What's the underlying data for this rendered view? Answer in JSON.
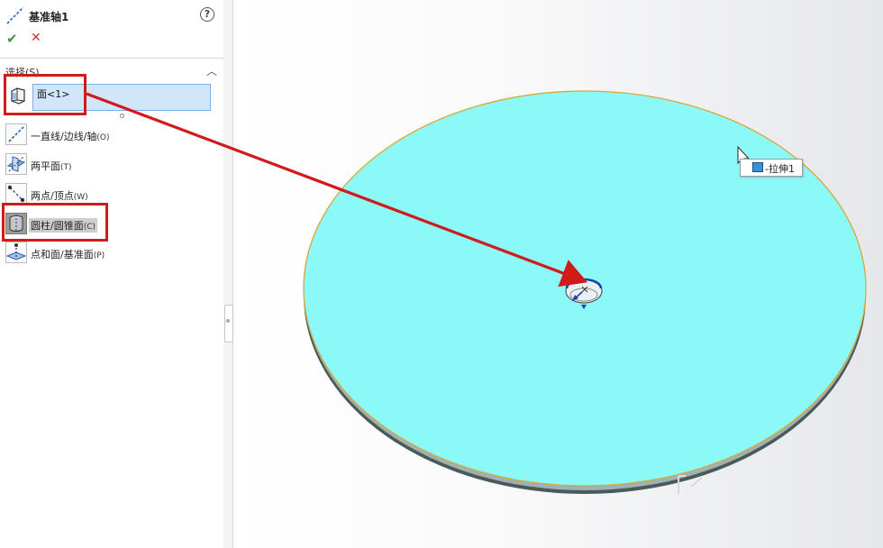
{
  "feature": {
    "title": "基准轴1",
    "help_label": "?",
    "ok_icon": "check-icon",
    "cancel_icon": "close-icon"
  },
  "selection": {
    "header": "选择(S)",
    "selected_item": "面<1>"
  },
  "axis_types": [
    {
      "label": "一直线/边线/轴",
      "shortcut": "(O)",
      "icon": "line-edge-axis-icon",
      "active": false
    },
    {
      "label": "两平面",
      "shortcut": "(T)",
      "icon": "two-planes-icon",
      "active": false
    },
    {
      "label": "两点/顶点",
      "shortcut": "(W)",
      "icon": "two-points-icon",
      "active": false
    },
    {
      "label": "圆柱/圆锥面",
      "shortcut": "(C)",
      "icon": "cylinder-cone-icon",
      "active": true
    },
    {
      "label": "点和面/基准面",
      "shortcut": "(P)",
      "icon": "point-plane-icon",
      "active": false
    }
  ],
  "viewport": {
    "tooltip_label": "-拉伸1",
    "face_color": "#8cf9f9",
    "edge_color": "#d8a838",
    "annotation_color": "#d11a1a"
  }
}
